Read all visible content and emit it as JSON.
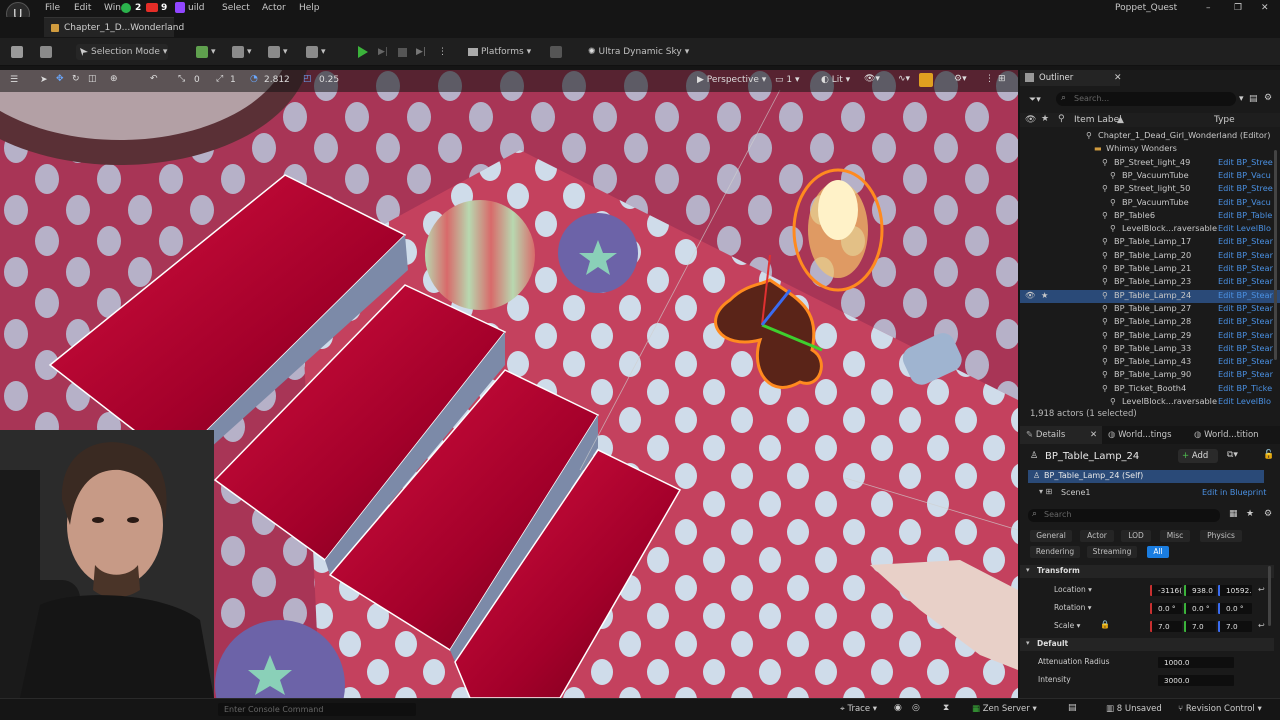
{
  "app": {
    "window_title": "Poppet_Quest",
    "document_tab": "Chapter_1_D...Wonderland"
  },
  "menu": [
    "File",
    "Edit",
    "Win",
    "2",
    "9",
    "uild",
    "Select",
    "Actor",
    "Help"
  ],
  "toolbar": {
    "selection_mode": "Selection Mode",
    "platforms": "Platforms",
    "sky": "Ultra Dynamic Sky"
  },
  "viewport_bar": {
    "rotation_snap": "0",
    "grid_snap": "1",
    "camera_speed": "2.812",
    "scale_snap": "0.25",
    "perspective": "Perspective",
    "lit": "Lit",
    "layout_count": "1"
  },
  "outliner": {
    "title": "Outliner",
    "search_placeholder": "Search...",
    "col_label": "Item Label",
    "col_type": "Type",
    "rows": [
      {
        "label": "Chapter_1_Dead_Girl_Wonderland (Editor)",
        "type": ""
      },
      {
        "label": "Whimsy Wonders",
        "type": ""
      },
      {
        "label": "BP_Street_light_49",
        "type": "Edit BP_Stree"
      },
      {
        "label": "BP_VacuumTube",
        "type": "Edit BP_Vacu"
      },
      {
        "label": "BP_Street_light_50",
        "type": "Edit BP_Stree"
      },
      {
        "label": "BP_VacuumTube",
        "type": "Edit BP_Vacu"
      },
      {
        "label": "BP_Table6",
        "type": "Edit BP_Table"
      },
      {
        "label": "LevelBlock...raversable",
        "type": "Edit LevelBlo"
      },
      {
        "label": "BP_Table_Lamp_17",
        "type": "Edit BP_Stear"
      },
      {
        "label": "BP_Table_Lamp_20",
        "type": "Edit BP_Stear"
      },
      {
        "label": "BP_Table_Lamp_21",
        "type": "Edit BP_Stear"
      },
      {
        "label": "BP_Table_Lamp_23",
        "type": "Edit BP_Stear"
      },
      {
        "label": "BP_Table_Lamp_24",
        "type": "Edit BP_Stear"
      },
      {
        "label": "BP_Table_Lamp_27",
        "type": "Edit BP_Stear"
      },
      {
        "label": "BP_Table_Lamp_28",
        "type": "Edit BP_Stear"
      },
      {
        "label": "BP_Table_Lamp_29",
        "type": "Edit BP_Stear"
      },
      {
        "label": "BP_Table_Lamp_33",
        "type": "Edit BP_Stear"
      },
      {
        "label": "BP_Table_Lamp_43",
        "type": "Edit BP_Stear"
      },
      {
        "label": "BP_Table_Lamp_90",
        "type": "Edit BP_Stear"
      },
      {
        "label": "BP_Ticket_Booth4",
        "type": "Edit BP_Ticke"
      },
      {
        "label": "LevelBlock...raversable",
        "type": "Edit LevelBlo"
      }
    ],
    "actor_count": "1,918 actors (1 selected)"
  },
  "details": {
    "tabs": [
      "Details",
      "World...tings",
      "World...tition"
    ],
    "actor_name": "BP_Table_Lamp_24",
    "add_label": "Add",
    "self_label": "BP_Table_Lamp_24 (Self)",
    "scene_label": "Scene1",
    "edit_blueprint": "Edit in Blueprint",
    "search_placeholder": "Search",
    "filters": [
      "General",
      "Actor",
      "LOD",
      "Misc",
      "Physics",
      "Rendering",
      "Streaming",
      "All"
    ],
    "transform_header": "Transform",
    "location_label": "Location",
    "rotation_label": "Rotation",
    "scale_label": "Scale",
    "location": [
      "-3116(",
      "938.0",
      "10592."
    ],
    "rotation": [
      "0.0 °",
      "0.0 °",
      "0.0 °"
    ],
    "scale": [
      "7.0",
      "7.0",
      "7.0"
    ],
    "default_header": "Default",
    "attenuation_label": "Attenuation Radius",
    "attenuation_value": "1000.0",
    "intensity_label": "Intensity",
    "intensity_value": "3000.0"
  },
  "statusbar": {
    "console_placeholder": "Enter Console Command",
    "trace": "Trace",
    "zen_server": "Zen Server",
    "unsaved": "8 Unsaved",
    "revision": "Revision Control"
  },
  "colors": {
    "accent_blue": "#2a4a78",
    "play_green": "#3bb33b",
    "floor_pink": "#b83a5a",
    "selection_orange": "#ff8a1f"
  }
}
